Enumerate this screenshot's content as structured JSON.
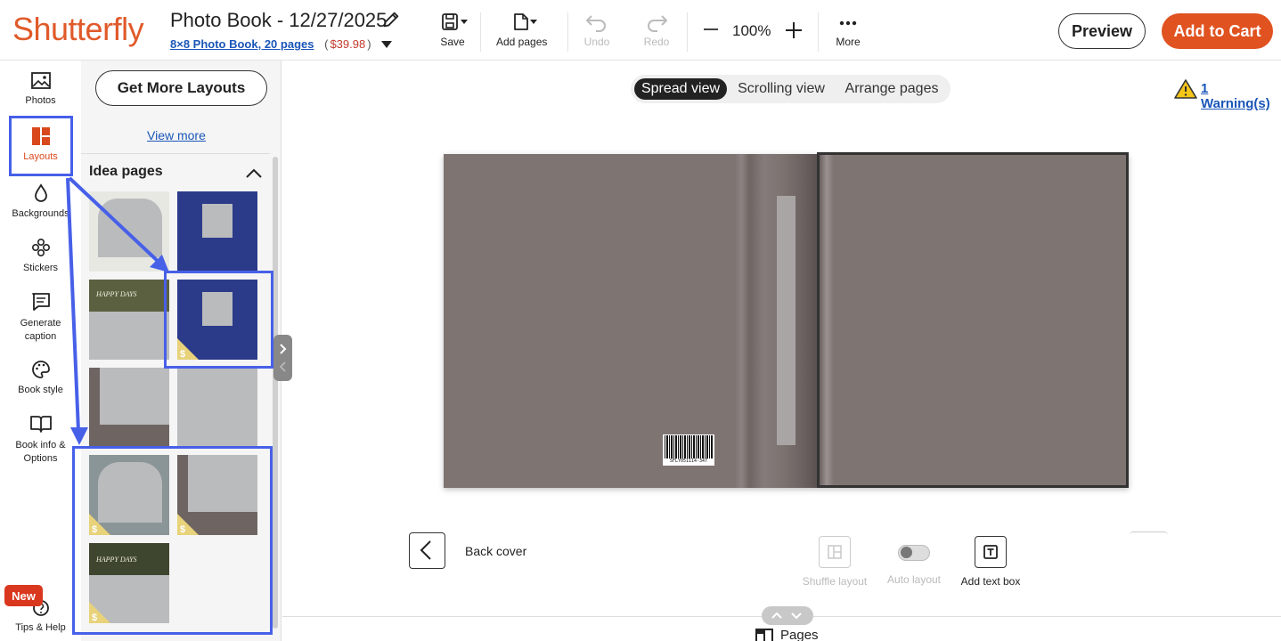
{
  "header": {
    "logo": "Shutterfly",
    "title": "Photo Book - 12/27/2025",
    "product_link": "8×8 Photo Book, 20 pages",
    "price_open": "(",
    "price": "$39.98",
    "price_close": ")",
    "tools": {
      "save": "Save",
      "add_pages": "Add pages",
      "undo": "Undo",
      "redo": "Redo",
      "more": "More"
    },
    "zoom": "100%",
    "preview": "Preview",
    "add_to_cart": "Add to Cart"
  },
  "rail": {
    "items": [
      {
        "label": "Photos",
        "icon": "image-icon"
      },
      {
        "label": "Layouts",
        "icon": "layouts-icon",
        "active": true
      },
      {
        "label": "Backgrounds",
        "icon": "droplet-icon"
      },
      {
        "label": "Stickers",
        "icon": "stickers-icon"
      },
      {
        "label": "Generate caption",
        "icon": "caption-icon"
      },
      {
        "label": "Book style",
        "icon": "palette-icon"
      },
      {
        "label": "Book info & Options",
        "icon": "book-icon"
      },
      {
        "label": "Tips & Help",
        "icon": "help-icon"
      }
    ],
    "new_badge": "New"
  },
  "panel": {
    "get_more_layouts": "Get More Layouts",
    "view_more": "View more",
    "section_title": "Idea pages",
    "thumbnail_text": "HAPPY DAYS"
  },
  "canvas": {
    "views": [
      "Spread view",
      "Scrolling view",
      "Arrange pages"
    ],
    "active_view": "Spread view",
    "warning": "1 Warning(s)",
    "barcode_text": "SFLY051114-347",
    "page_label": "Back cover",
    "actions": {
      "shuffle": "Shuffle layout",
      "auto": "Auto layout",
      "add_text": "Add text box"
    },
    "pages": "Pages"
  },
  "colors": {
    "brand": "#e05a2a",
    "cart": "#e0521f",
    "highlight": "#4760e8",
    "cover": "#7e7472",
    "navy": "#2b3b8a",
    "olive": "#5b6040"
  }
}
